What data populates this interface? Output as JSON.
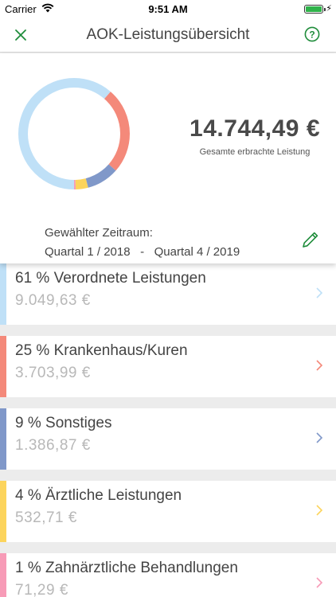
{
  "status": {
    "carrier": "Carrier",
    "time": "9:51 AM"
  },
  "nav": {
    "title": "AOK-Leistungsübersicht"
  },
  "summary": {
    "total": "14.744,49 €",
    "total_caption": "Gesamte erbrachte Leistung",
    "period_label": "Gewählter Zeitraum:",
    "period_from": "Quartal 1 / 2018",
    "period_sep": "-",
    "period_to": "Quartal 4 / 2019"
  },
  "colors": {
    "accent": "#1e8c3a",
    "verordnet": "#bfe0f7",
    "krankenhaus": "#f4897a",
    "sonstiges": "#8098c9",
    "aerztlich": "#fcd45c",
    "zahn": "#f79bb7"
  },
  "chart_data": {
    "type": "pie",
    "categories": [
      "Verordnete Leistungen",
      "Krankenhaus/Kuren",
      "Sonstiges",
      "Ärztliche Leistungen",
      "Zahnärztliche Behandlungen"
    ],
    "values": [
      9049.63,
      3703.99,
      1386.87,
      532.71,
      71.29
    ]
  },
  "categories": [
    {
      "label": "61 % Verordnete Leistungen",
      "value": "9.049,63 €",
      "color": "#bfe0f7"
    },
    {
      "label": "25 % Krankenhaus/Kuren",
      "value": "3.703,99 €",
      "color": "#f4897a"
    },
    {
      "label": "9 % Sonstiges",
      "value": "1.386,87 €",
      "color": "#8098c9"
    },
    {
      "label": "4 % Ärztliche Leistungen",
      "value": "532,71 €",
      "color": "#fcd45c"
    },
    {
      "label": "1 % Zahnärztliche Behandlungen",
      "value": "71,29 €",
      "color": "#f79bb7"
    }
  ]
}
